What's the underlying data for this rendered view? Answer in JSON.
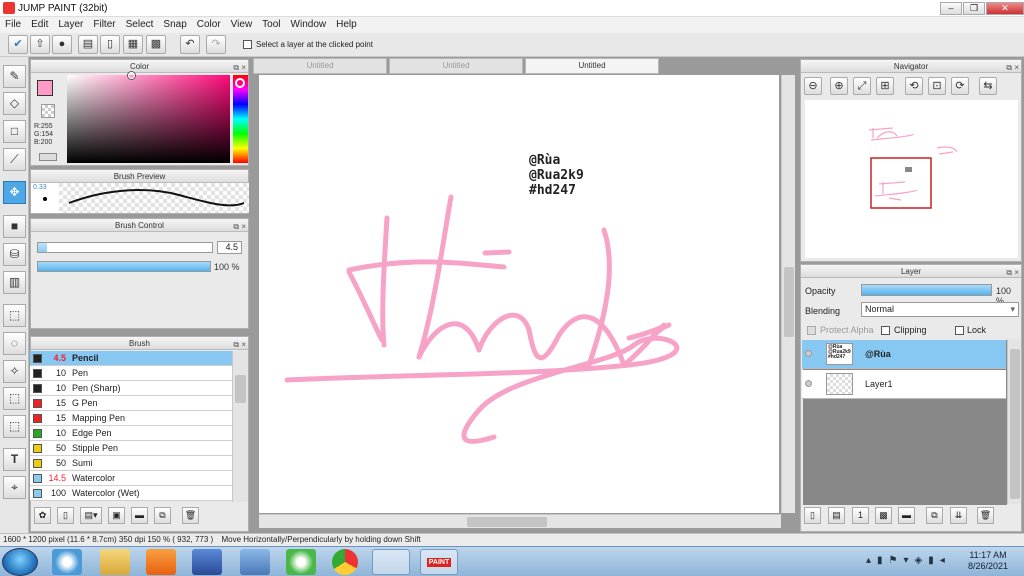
{
  "window": {
    "title": "JUMP PAINT (32bit)",
    "min": "–",
    "max": "❐",
    "close": "✕"
  },
  "menu": [
    "File",
    "Edit",
    "Layer",
    "Filter",
    "Select",
    "Snap",
    "Color",
    "View",
    "Tool",
    "Window",
    "Help"
  ],
  "toolbar": {
    "select_layer_label": "Select a layer at the clicked point"
  },
  "panels": {
    "color": {
      "title": "Color",
      "readout": {
        "r": "R:255",
        "g": "G:154",
        "b": "B:200"
      },
      "main_color": "#ff9ac8"
    },
    "brush_preview": {
      "title": "Brush Preview",
      "size": "0.33"
    },
    "brush_control": {
      "title": "Brush Control",
      "size_value": "4.5",
      "opacity_value": "100 %",
      "size_fraction": 0.05,
      "opacity_fraction": 1.0
    },
    "brush": {
      "title": "Brush",
      "items": [
        {
          "size": "4.5",
          "name": "Pencil",
          "color": "#222222",
          "selected": true,
          "size_highlight": true
        },
        {
          "size": "10",
          "name": "Pen",
          "color": "#222222"
        },
        {
          "size": "10",
          "name": "Pen (Sharp)",
          "color": "#222222"
        },
        {
          "size": "15",
          "name": "G Pen",
          "color": "#ee2222"
        },
        {
          "size": "15",
          "name": "Mapping Pen",
          "color": "#ee2222"
        },
        {
          "size": "10",
          "name": "Edge Pen",
          "color": "#22aa22"
        },
        {
          "size": "50",
          "name": "Stipple Pen",
          "color": "#eecc11"
        },
        {
          "size": "50",
          "name": "Sumi",
          "color": "#eecc11"
        },
        {
          "size": "14.5",
          "name": "Watercolor",
          "color": "#88ccee",
          "size_highlight": true
        },
        {
          "size": "100",
          "name": "Watercolor (Wet)",
          "color": "#88ccee"
        }
      ]
    },
    "navigator": {
      "title": "Navigator"
    },
    "layer": {
      "title": "Layer",
      "opacity_label": "Opacity",
      "opacity_value": "100 %",
      "blending_label": "Blending",
      "blending_value": "Normal",
      "protect_alpha": "Protect Alpha",
      "clipping": "Clipping",
      "lock": "Lock",
      "layers": [
        {
          "name": "@Rùa",
          "thumb_text": "@Rùa @Rua2k9 #hd247",
          "selected": true
        },
        {
          "name": "Layer1",
          "selected": false
        }
      ]
    }
  },
  "tabs": [
    {
      "label": "Untitled",
      "active": false
    },
    {
      "label": "Untitled",
      "active": false
    },
    {
      "label": "Untitled",
      "active": true
    }
  ],
  "canvas": {
    "text_lines": [
      "@Rùa",
      "@Rua2k9",
      "#hd247"
    ],
    "ink_color": "#f7a3c8"
  },
  "status": {
    "info": "1600 * 1200 pixel  (11.6 * 8.7cm)  350 dpi  150 %  ( 932, 773 )",
    "hint": "Move Horizontally/Perpendicularly by holding down Shift"
  },
  "taskbar": {
    "time": "11:17 AM",
    "date": "8/26/2021",
    "paint_app": "PAINT"
  }
}
